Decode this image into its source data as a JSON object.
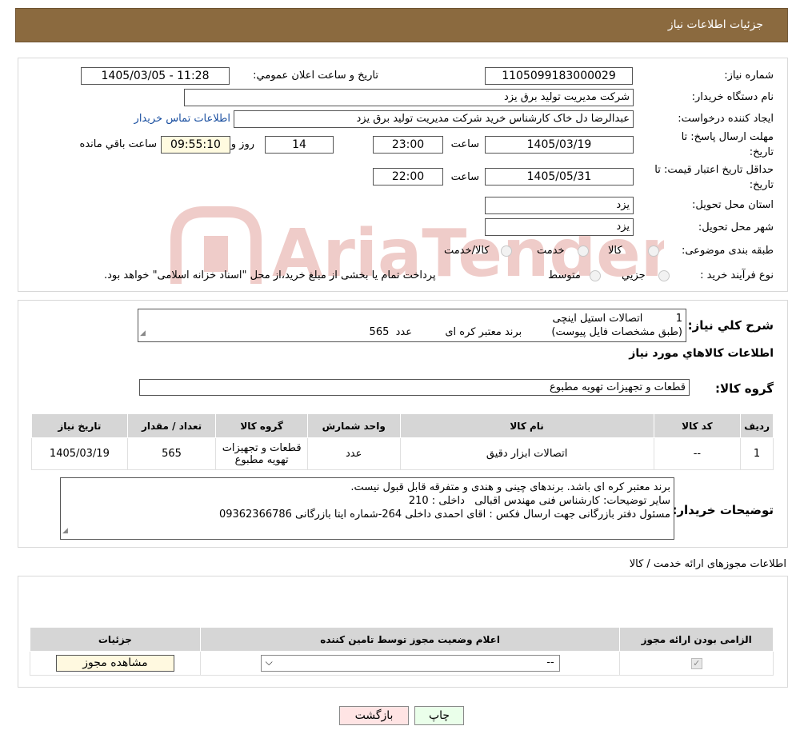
{
  "header": {
    "title": "جزئیات اطلاعات نیاز"
  },
  "watermark": {
    "text": "AriaTender.neT",
    "color": "#c0392b"
  },
  "details": {
    "need_number_label": "شماره نیاز:",
    "need_number": "1105099183000029",
    "announce_label": "تاریخ و ساعت اعلان عمومي:",
    "announce_value": "1405/03/05 - 11:28",
    "buyer_org_label": "نام دستگاه خريدار:",
    "buyer_org": "شرکت مدیریت تولید برق یزد",
    "creator_label": "ايجاد كننده درخواست:",
    "creator": "عبدالرضا دل خاک کارشناس خرید شرکت مدیریت تولید برق یزد",
    "contact_link": "اطلاعات تماس خريدار",
    "deadline_label_1": "مهلت ارسال پاسخ: تا",
    "deadline_label_2": "تاريخ:",
    "deadline_date": "1405/03/19",
    "time_label": "ساعت",
    "deadline_time": "23:00",
    "days_value": "14",
    "days_label": "روز و",
    "remaining_time": "09:55:10",
    "remaining_label": "ساعت باقي مانده",
    "validity_label_1": "حداقل تاريخ اعتبار قيمت: تا",
    "validity_label_2": "تاريخ:",
    "validity_date": "1405/05/31",
    "validity_time": "22:00",
    "province_label": "استان محل تحويل:",
    "province": "یزد",
    "city_label": "شهر محل تحويل:",
    "city": "یزد",
    "category_label": "طبقه بندی موضوعی:",
    "category_options": [
      "کالا",
      "خدمت",
      "کالا/خدمت"
    ],
    "purchase_type_label": "نوع فرآيند خريد :",
    "purchase_options": [
      "جزيي",
      "متوسط"
    ],
    "purchase_note": "پرداخت تمام یا بخشی از مبلغ خرید،از محل \"اسناد خزانه اسلامی\" خواهد بود."
  },
  "summary": {
    "label": "شرح کلي نياز:",
    "line1": "1          اتصالات استیل اینچی",
    "line2": "(طبق مشخصات فایل پیوست)         برند معتبر کره ای          عدد  565"
  },
  "goods": {
    "title": "اطلاعات كالاهاي مورد نياز",
    "group_label": "گروه كالا:",
    "group_value": "قطعات و تجهیزات تهویه مطبوع",
    "columns": [
      "رديف",
      "كد كالا",
      "نام كالا",
      "واحد شمارش",
      "گروه كالا",
      "تعداد / مقدار",
      "تاريخ نياز"
    ],
    "rows": [
      [
        "1",
        "--",
        "اتصالات ابزار دقیق",
        "عدد",
        "قطعات و تجهیزات تهویه مطبوع",
        "565",
        "1405/03/19"
      ]
    ]
  },
  "buyer_notes": {
    "label": "توضيحات خريدار:",
    "line1": "برند معتبر کره ای باشد. برندهای چینی و هندی و متفرقه قابل قبول نیست.",
    "line2": "سایر توضیحات: کارشناس فنی مهندس اقبالی   داخلی : 210",
    "line3": "مسئول دفتر بازرگانی جهت ارسال فکس : اقای احمدی داخلی 264-شماره ایتا بازرگانی 09362366786"
  },
  "licenses": {
    "title": "اطلاعات مجوزهای ارائه خدمت / کالا",
    "columns": [
      "الزامی بودن ارائه مجوز",
      "اعلام وضعیت مجوز توسط تامین کننده",
      "جزئیات"
    ],
    "select_value": "--",
    "view_button": "مشاهده مجوز"
  },
  "footer": {
    "print_button": "چاپ",
    "back_button": "بازگشت"
  }
}
